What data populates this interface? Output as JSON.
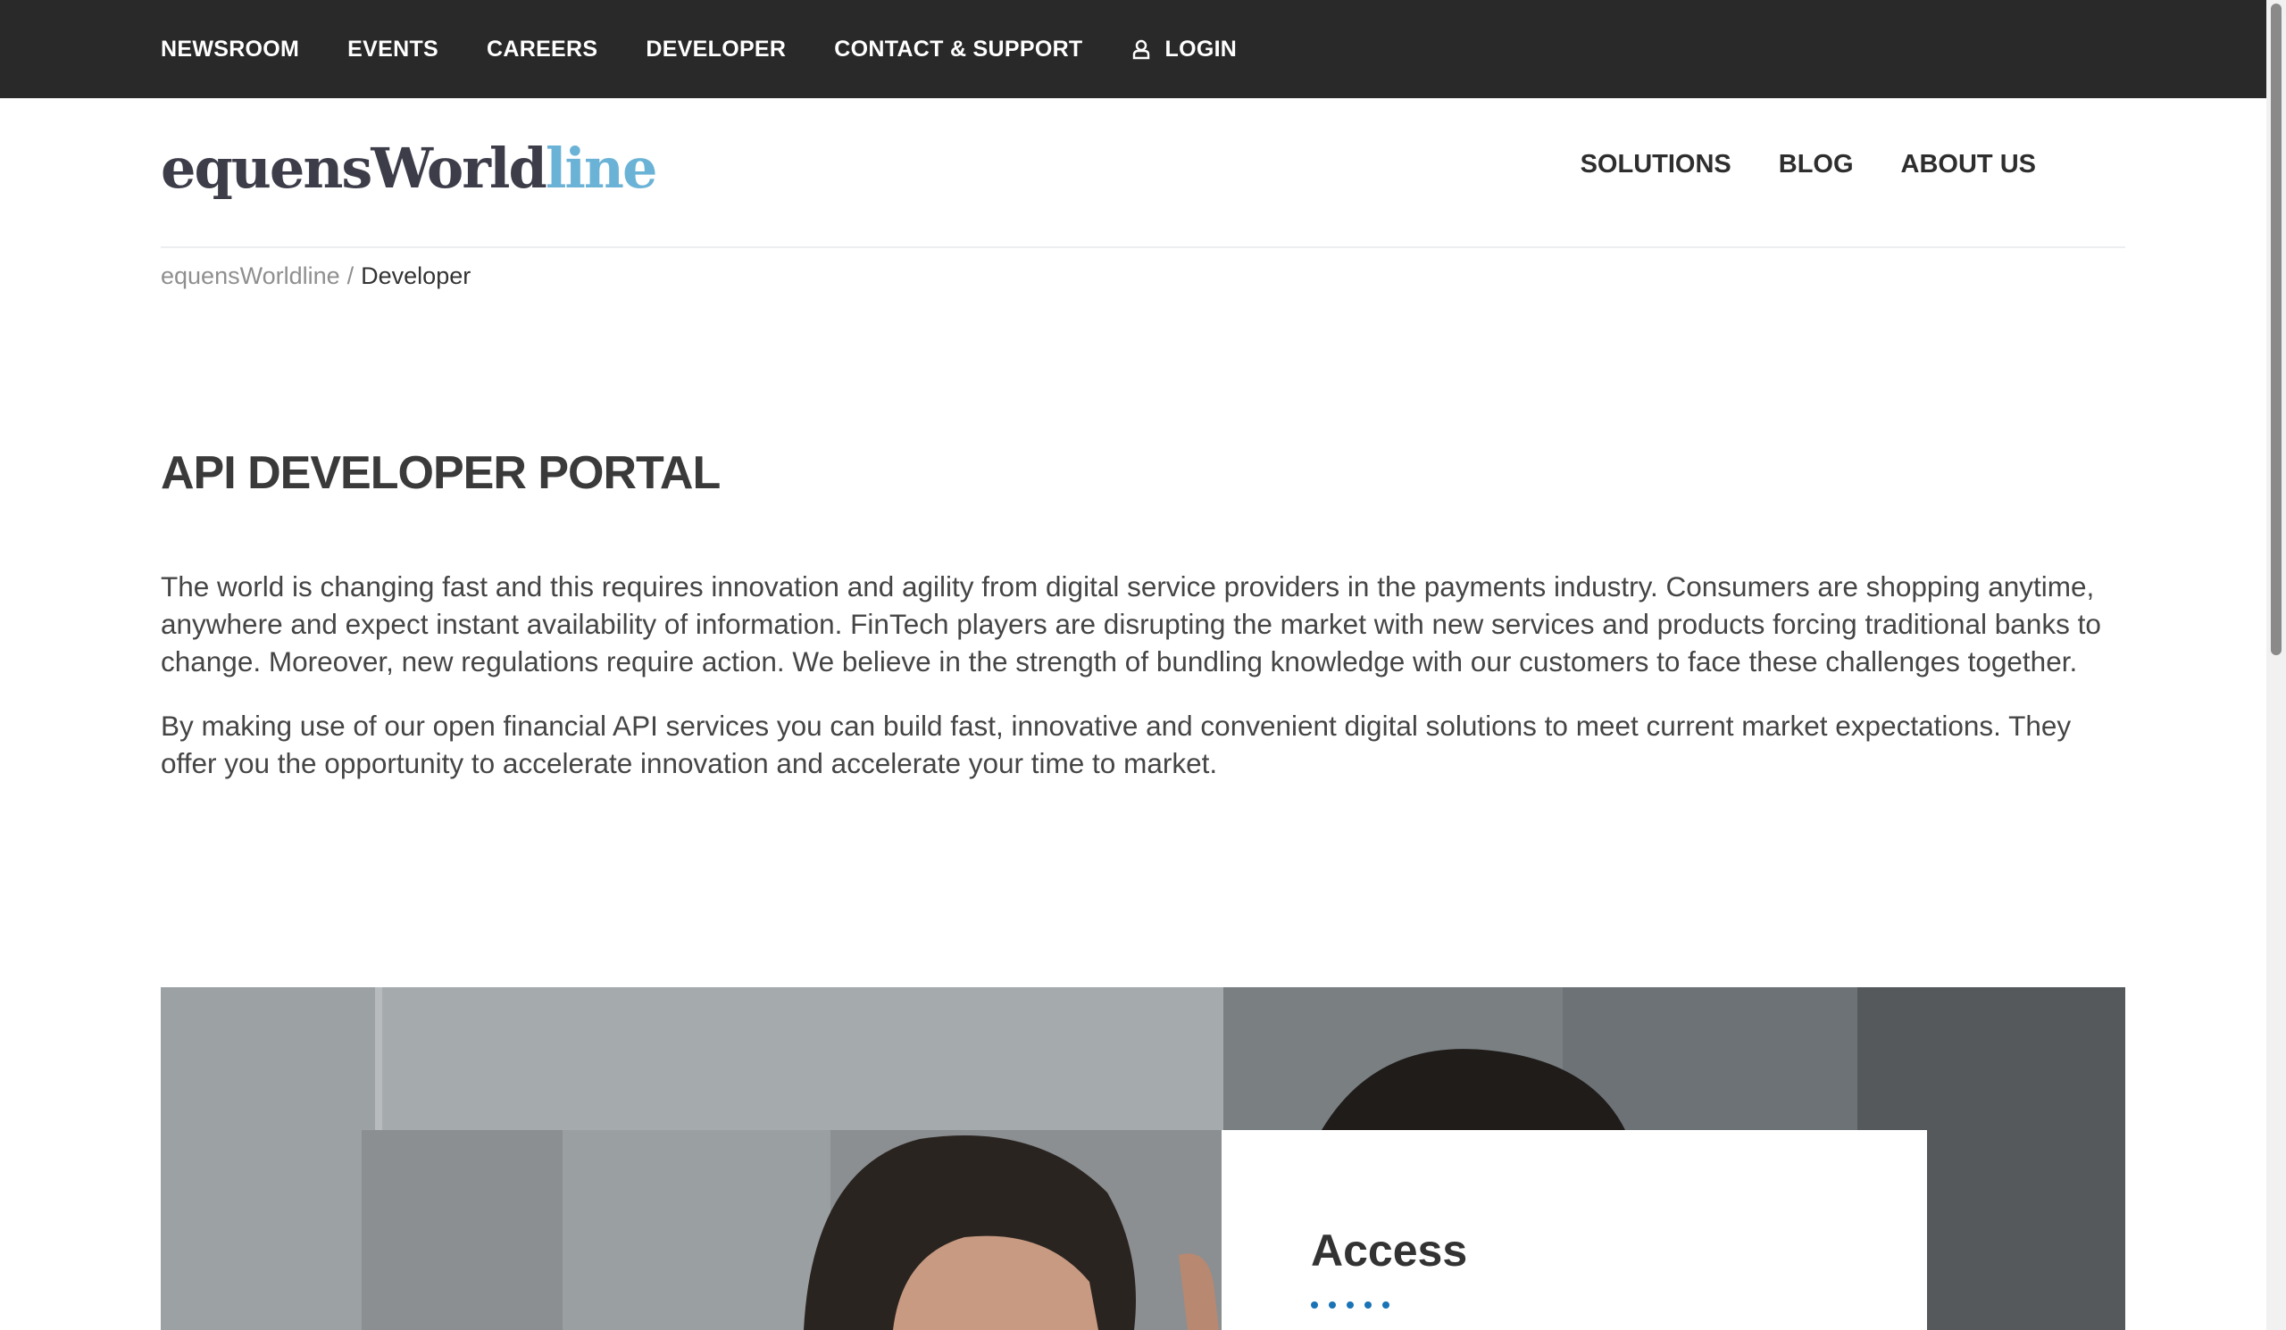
{
  "topbar": {
    "links": [
      "NEWSROOM",
      "EVENTS",
      "CAREERS",
      "DEVELOPER",
      "CONTACT & SUPPORT"
    ],
    "login_label": "LOGIN"
  },
  "header": {
    "logo_part1": "equens",
    "logo_part2": "World",
    "logo_part3": "line",
    "nav": [
      "SOLUTIONS",
      "BLOG",
      "ABOUT US"
    ]
  },
  "breadcrumb": {
    "home": "equensWorldline",
    "separator": "/",
    "current": "Developer"
  },
  "intro": {
    "title": "API DEVELOPER PORTAL",
    "paragraph_1": "The world is changing fast and this requires innovation and agility from digital service providers in the payments industry. Consumers are shopping anytime, anywhere and expect instant availability of information. FinTech players are disrupting the market with new services and products forcing traditional banks to change. Moreover, new regulations require action. We believe in the strength of bundling knowledge with our customers to face these challenges together.",
    "paragraph_2": "By making use of our open financial API services you can build fast, innovative and convenient digital solutions to meet current market expectations. They offer you the opportunity to accelerate innovation and accelerate your time to market."
  },
  "hero": {
    "card_title": "Access"
  },
  "colors": {
    "topbar_bg": "#292929",
    "logo_dark": "#3d3d4a",
    "logo_accent": "#6bb3d6",
    "dot_accent": "#1a73b5"
  },
  "icons": {
    "login": "user-icon",
    "dots": "dotted-divider"
  }
}
